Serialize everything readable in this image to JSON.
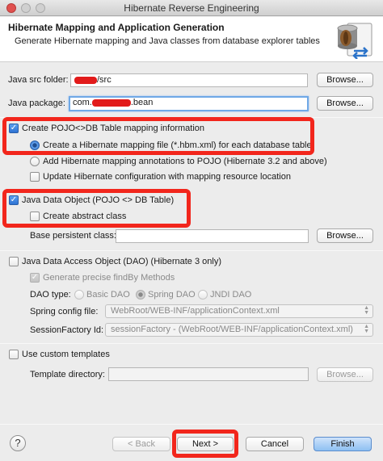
{
  "window": {
    "title": "Hibernate Reverse Engineering"
  },
  "banner": {
    "title": "Hibernate Mapping and Application Generation",
    "description": "Generate Hibernate mapping and Java classes from database explorer tables",
    "icon": "database-wizard-icon"
  },
  "src_folder": {
    "label": "Java src folder:",
    "value": "/src",
    "browse": "Browse..."
  },
  "package": {
    "label": "Java package:",
    "prefix": "com.",
    "suffix": ".bean",
    "browse": "Browse..."
  },
  "pojo_mapping": {
    "label": "Create POJO<>DB Table mapping information",
    "checked": true,
    "options": [
      {
        "label": "Create a Hibernate mapping file (*.hbm.xml) for each database table",
        "checked": true
      },
      {
        "label": "Add Hibernate mapping annotations to POJO (Hibernate 3.2 and above)",
        "checked": false
      }
    ],
    "update_config": {
      "label": "Update Hibernate configuration with mapping resource location",
      "checked": false
    }
  },
  "java_data_object": {
    "label": "Java Data Object (POJO <> DB Table)",
    "checked": true,
    "abstract_class": {
      "label": "Create abstract class",
      "checked": false
    },
    "base_class": {
      "label": "Base persistent class:",
      "value": "",
      "browse": "Browse..."
    }
  },
  "dao": {
    "label": "Java Data Access Object (DAO) (Hibernate 3 only)",
    "checked": false,
    "findby": {
      "label": "Generate precise findBy Methods",
      "checked": true
    },
    "type_label": "DAO type:",
    "types": [
      {
        "label": "Basic DAO",
        "checked": false
      },
      {
        "label": "Spring DAO",
        "checked": true
      },
      {
        "label": "JNDI DAO",
        "checked": false
      }
    ],
    "spring_config": {
      "label": "Spring config file:",
      "value": "WebRoot/WEB-INF/applicationContext.xml"
    },
    "session_factory": {
      "label": "SessionFactory Id:",
      "value": "sessionFactory - (WebRoot/WEB-INF/applicationContext.xml)"
    }
  },
  "templates": {
    "label": "Use custom templates",
    "checked": false,
    "directory_label": "Template directory:",
    "directory_value": "",
    "browse": "Browse..."
  },
  "footer": {
    "help": "?",
    "back": "< Back",
    "next": "Next >",
    "cancel": "Cancel",
    "finish": "Finish"
  },
  "colors": {
    "highlight": "#f2261c",
    "redaction": "#e21b1b",
    "focus": "#6fa8e6"
  }
}
